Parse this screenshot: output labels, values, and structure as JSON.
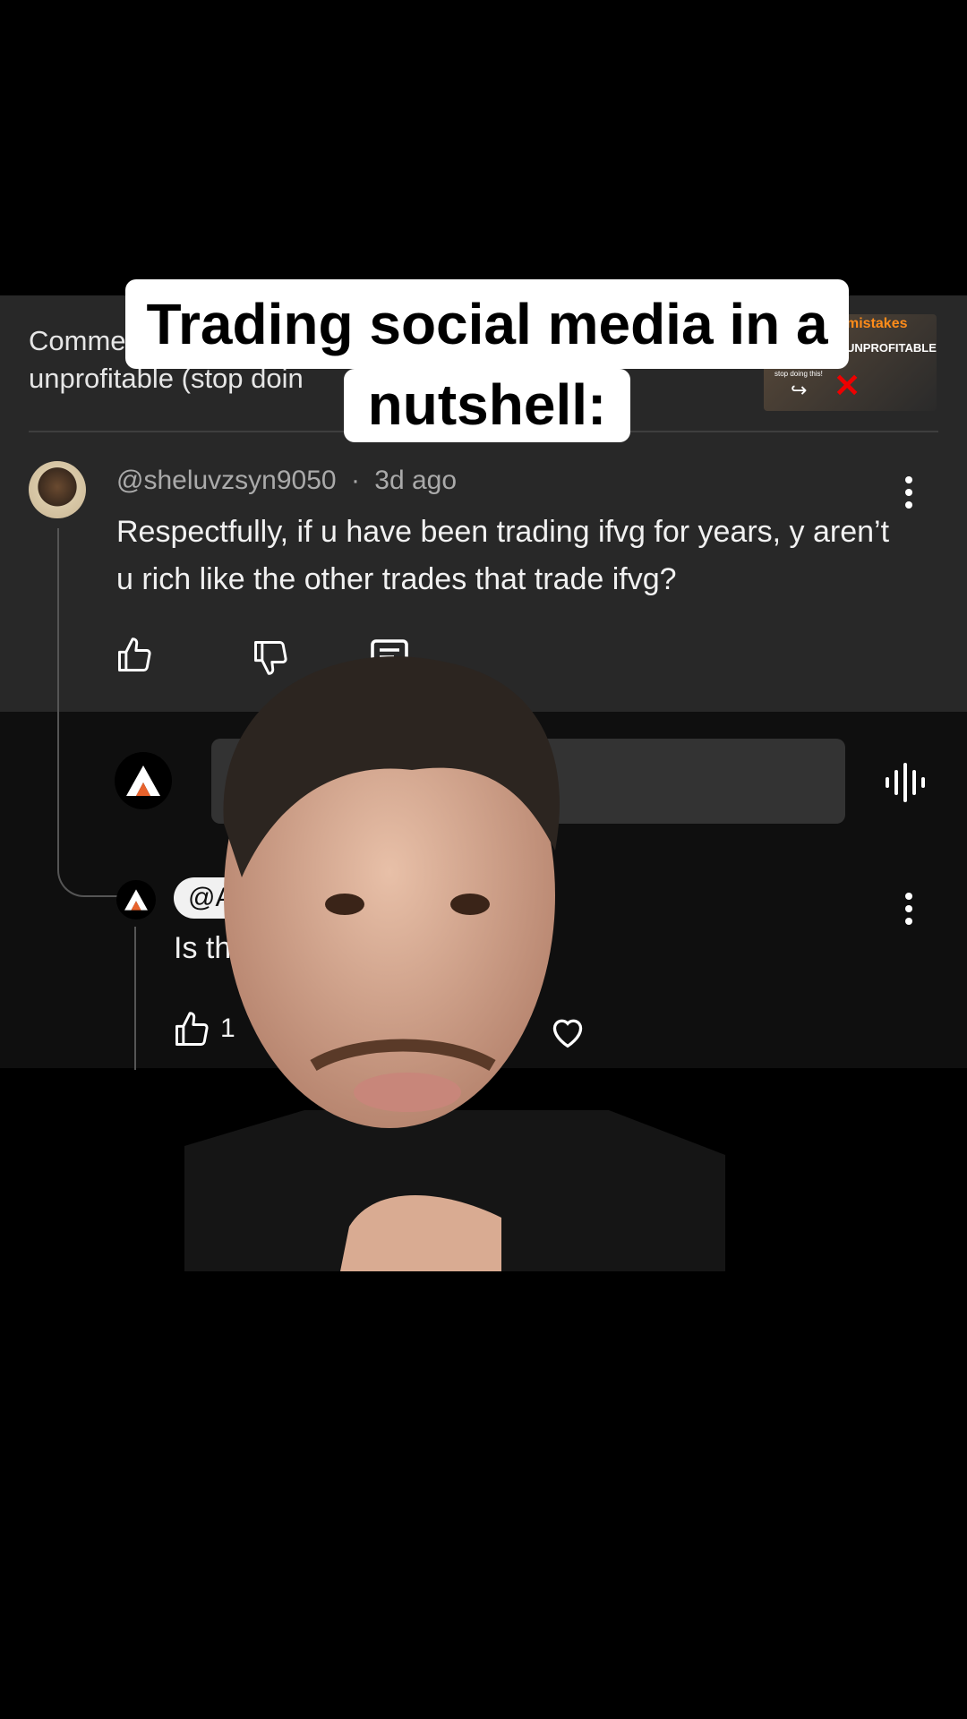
{
  "caption": {
    "line1": "Trading social media in a",
    "line2": "nutshell:"
  },
  "video_header": {
    "text_line1": "Comme",
    "text_line2": "unprofitable (stop doin",
    "thumbnail": {
      "text_top": "mistakes",
      "text_mid": "UNPROFITABLE",
      "text_small": "stop doing this!",
      "icon": "red-x"
    }
  },
  "comment": {
    "author": "@sheluvzsyn9050",
    "separator": "·",
    "time": "3d ago",
    "text": "Respectfully, if u have been trading ifvg for years, y aren’t u rich like the other trades that trade ifvg?",
    "actions": [
      "like-icon",
      "dislike-icon",
      "reply-icon"
    ]
  },
  "reply_box": {
    "placeholder": "A"
  },
  "reply": {
    "mention": "@Aide",
    "text": "Is this",
    "likes": "1"
  }
}
